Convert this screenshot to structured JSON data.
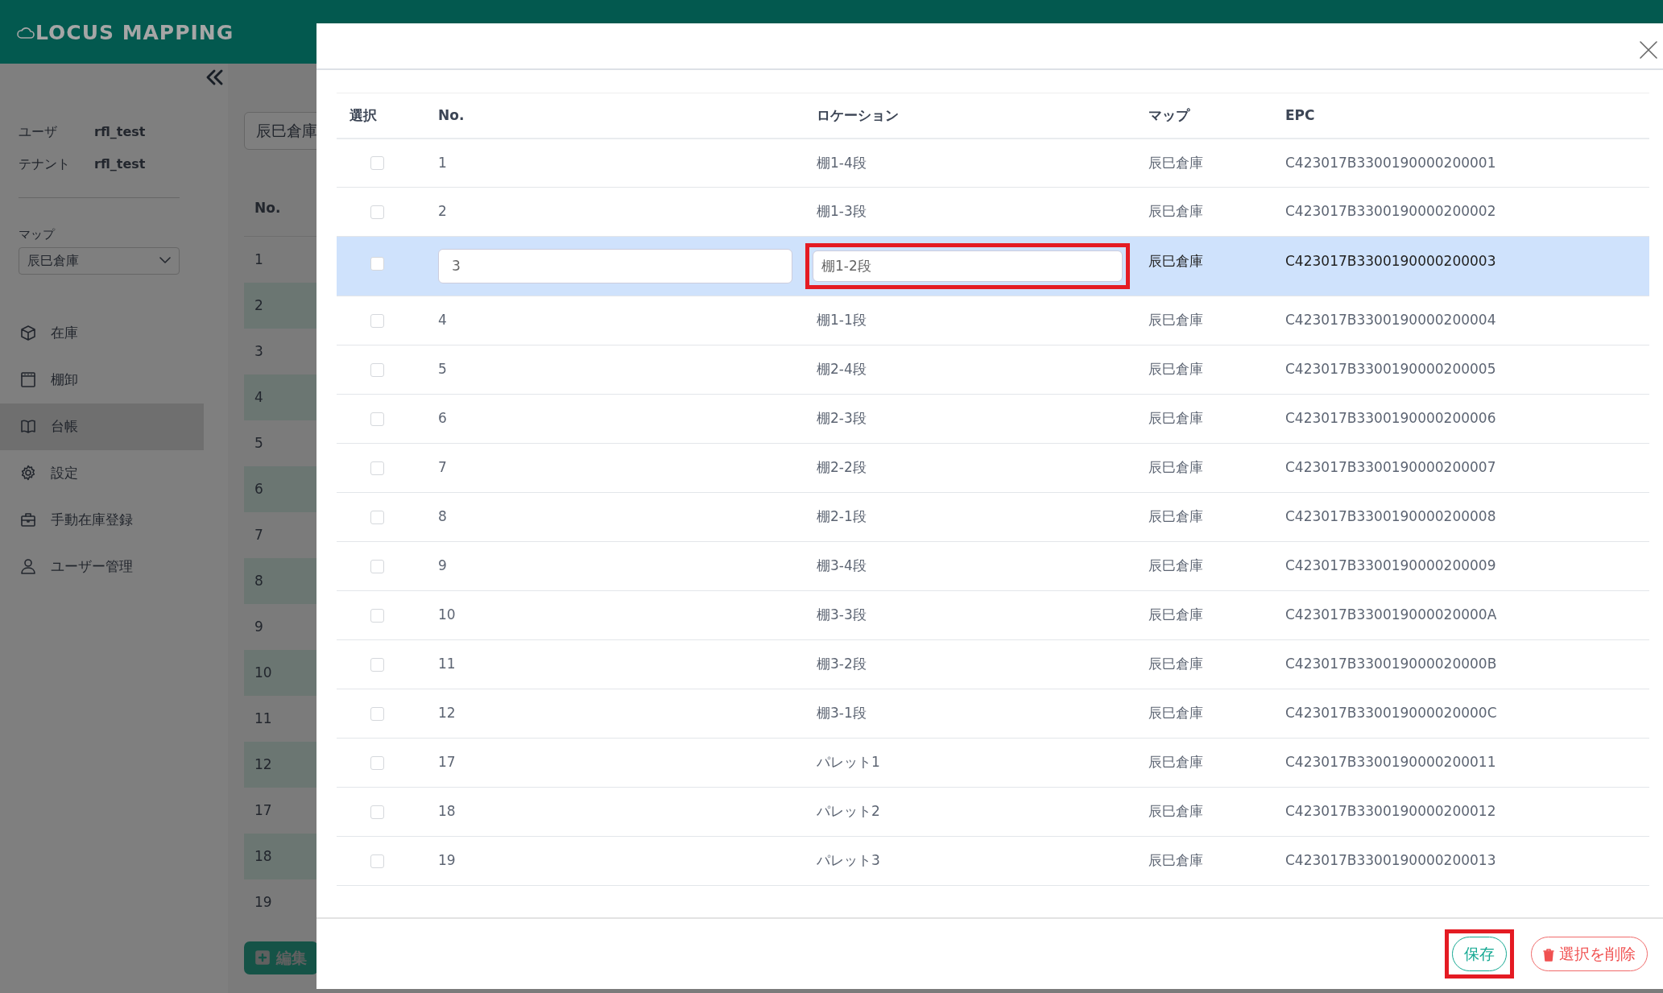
{
  "app": {
    "title": "LOCUS MAPPING"
  },
  "sidebar": {
    "user_label": "ユーザ",
    "user": "rfl_test",
    "tenant_label": "テナント",
    "tenant": "rfl_test",
    "map_label": "マップ",
    "map": "辰巳倉庫",
    "items": [
      {
        "label": "在庫",
        "kind": "box",
        "selected": false
      },
      {
        "label": "棚卸",
        "kind": "calendar",
        "selected": false
      },
      {
        "label": "台帳",
        "kind": "book",
        "selected": true
      },
      {
        "label": "設定",
        "kind": "gear",
        "selected": false
      },
      {
        "label": "手動在庫登録",
        "kind": "case",
        "selected": false
      },
      {
        "label": "ユーザー管理",
        "kind": "user",
        "selected": false
      }
    ]
  },
  "background": {
    "search_value": "辰巳倉庫",
    "column": "No.",
    "rows": [
      "1",
      "2",
      "3",
      "4",
      "5",
      "6",
      "7",
      "8",
      "9",
      "10",
      "11",
      "12",
      "17",
      "18",
      "19"
    ],
    "edit_button": "編集"
  },
  "modal": {
    "columns": [
      "選択",
      "No.",
      "ロケーション",
      "マップ",
      "EPC"
    ],
    "rows": [
      {
        "no": "1",
        "location": "棚1-4段",
        "map": "辰巳倉庫",
        "epc": "C423017B3300190000200001",
        "checked": false,
        "selected": false,
        "editing": false,
        "highlighted": false
      },
      {
        "no": "2",
        "location": "棚1-3段",
        "map": "辰巳倉庫",
        "epc": "C423017B3300190000200002",
        "checked": false,
        "selected": false,
        "editing": false,
        "highlighted": false
      },
      {
        "no": "3",
        "location": "棚1-2段",
        "map": "辰巳倉庫",
        "epc": "C423017B3300190000200003",
        "checked": false,
        "selected": true,
        "editing": true,
        "highlighted": true
      },
      {
        "no": "4",
        "location": "棚1-1段",
        "map": "辰巳倉庫",
        "epc": "C423017B3300190000200004",
        "checked": false,
        "selected": false,
        "editing": false,
        "highlighted": false
      },
      {
        "no": "5",
        "location": "棚2-4段",
        "map": "辰巳倉庫",
        "epc": "C423017B3300190000200005",
        "checked": false,
        "selected": false,
        "editing": false,
        "highlighted": false
      },
      {
        "no": "6",
        "location": "棚2-3段",
        "map": "辰巳倉庫",
        "epc": "C423017B3300190000200006",
        "checked": false,
        "selected": false,
        "editing": false,
        "highlighted": false
      },
      {
        "no": "7",
        "location": "棚2-2段",
        "map": "辰巳倉庫",
        "epc": "C423017B3300190000200007",
        "checked": false,
        "selected": false,
        "editing": false,
        "highlighted": false
      },
      {
        "no": "8",
        "location": "棚2-1段",
        "map": "辰巳倉庫",
        "epc": "C423017B3300190000200008",
        "checked": false,
        "selected": false,
        "editing": false,
        "highlighted": false
      },
      {
        "no": "9",
        "location": "棚3-4段",
        "map": "辰巳倉庫",
        "epc": "C423017B3300190000200009",
        "checked": false,
        "selected": false,
        "editing": false,
        "highlighted": false
      },
      {
        "no": "10",
        "location": "棚3-3段",
        "map": "辰巳倉庫",
        "epc": "C423017B330019000020000A",
        "checked": false,
        "selected": false,
        "editing": false,
        "highlighted": false
      },
      {
        "no": "11",
        "location": "棚3-2段",
        "map": "辰巳倉庫",
        "epc": "C423017B330019000020000B",
        "checked": false,
        "selected": false,
        "editing": false,
        "highlighted": false
      },
      {
        "no": "12",
        "location": "棚3-1段",
        "map": "辰巳倉庫",
        "epc": "C423017B330019000020000C",
        "checked": false,
        "selected": false,
        "editing": false,
        "highlighted": false
      },
      {
        "no": "17",
        "location": "パレット1",
        "map": "辰巳倉庫",
        "epc": "C423017B3300190000200011",
        "checked": false,
        "selected": false,
        "editing": false,
        "highlighted": false
      },
      {
        "no": "18",
        "location": "パレット2",
        "map": "辰巳倉庫",
        "epc": "C423017B3300190000200012",
        "checked": false,
        "selected": false,
        "editing": false,
        "highlighted": false
      },
      {
        "no": "19",
        "location": "パレット3",
        "map": "辰巳倉庫",
        "epc": "C423017B3300190000200013",
        "checked": false,
        "selected": false,
        "editing": false,
        "highlighted": false
      }
    ],
    "buttons": [
      {
        "label": "保存",
        "kind": "save",
        "highlighted": true
      },
      {
        "label": "選択を削除",
        "kind": "delete",
        "highlighted": false
      }
    ]
  }
}
